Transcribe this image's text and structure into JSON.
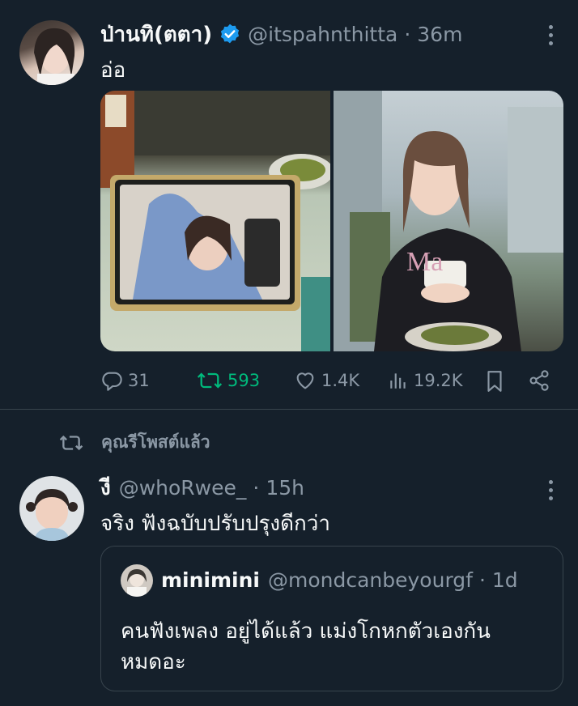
{
  "tweet1": {
    "display_name": "ป่านทิ(ตตา)",
    "handle": "@itspahnthitta",
    "separator": "·",
    "time": "36m",
    "text": "อ่อ",
    "verified_color": "#1d9bf0",
    "actions": {
      "replies": "31",
      "retweets": "593",
      "likes": "1.4K",
      "views": "19.2K"
    },
    "retweet_color": "#00ba7c",
    "images": [
      "photo-tablet-selfie",
      "photo-woman-phone"
    ]
  },
  "retweet_notice": {
    "icon": "retweet-icon",
    "label": "คุณรีโพสต์แล้ว"
  },
  "tweet2": {
    "display_name": "งี",
    "handle": "@whoRwee_",
    "separator": "·",
    "time": "15h",
    "text": "จริง ฟังฉบับปรับปรุงดีกว่า",
    "quote": {
      "display_name": "minimini",
      "handle": "@mondcanbeyourgf",
      "separator": "·",
      "time": "1d",
      "text_line1": "คนฟังเพลง อยู่ได้แล้ว แม่งโกหกตัวเองกัน",
      "text_line2": "หมดอะ"
    }
  }
}
